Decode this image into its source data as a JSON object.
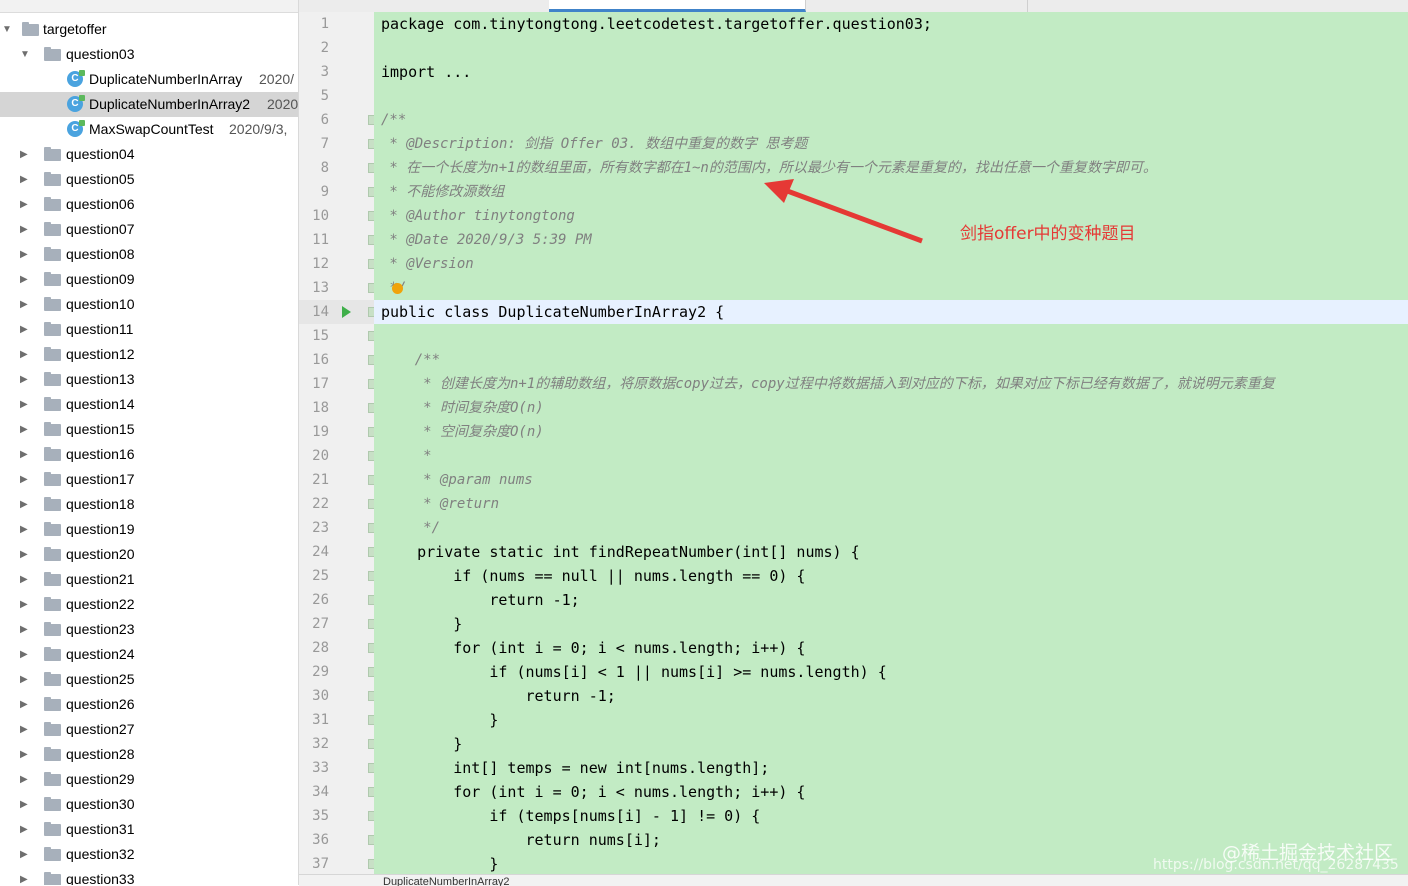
{
  "sidebar": {
    "root": "targetoffer",
    "expanded_folder": "question03",
    "files": [
      {
        "name": "DuplicateNumberInArray",
        "meta": "2020/"
      },
      {
        "name": "DuplicateNumberInArray2",
        "meta": "2020"
      },
      {
        "name": "MaxSwapCountTest",
        "meta": "2020/9/3,"
      }
    ],
    "folders": [
      "question04",
      "question05",
      "question06",
      "question07",
      "question08",
      "question09",
      "question10",
      "question11",
      "question12",
      "question13",
      "question14",
      "question15",
      "question16",
      "question17",
      "question18",
      "question19",
      "question20",
      "question21",
      "question22",
      "question23",
      "question24",
      "question25",
      "question26",
      "question27",
      "question28",
      "question29",
      "question30",
      "question31",
      "question32",
      "question33"
    ]
  },
  "editor": {
    "line_numbers": [
      "1",
      "2",
      "3",
      "5",
      "6",
      "7",
      "8",
      "9",
      "10",
      "11",
      "12",
      "13",
      "14",
      "15",
      "16",
      "17",
      "18",
      "19",
      "20",
      "21",
      "22",
      "23",
      "24",
      "25",
      "26",
      "27",
      "28",
      "29",
      "30",
      "31",
      "32",
      "33",
      "34",
      "35",
      "36",
      "37"
    ],
    "lines": [
      "package com.tinytongtong.leetcodetest.targetoffer.question03;",
      "",
      "import ...",
      "",
      "/**",
      " * @Description: 剑指 Offer 03. 数组中重复的数字 思考题",
      " * 在一个长度为n+1的数组里面，所有数字都在1~n的范围内，所以最少有一个元素是重复的，找出任意一个重复数字即可。",
      " * 不能修改源数组",
      " * @Author tinytongtong",
      " * @Date 2020/9/3 5:39 PM",
      " * @Version",
      " */",
      "public class DuplicateNumberInArray2 {",
      "",
      "    /**",
      "     * 创建长度为n+1的辅助数组，将原数据copy过去，copy过程中将数据插入到对应的下标，如果对应下标已经有数据了，就说明元素重复",
      "     * 时间复杂度O(n)",
      "     * 空间复杂度O(n)",
      "     *",
      "     * @param nums",
      "     * @return",
      "     */",
      "    private static int findRepeatNumber(int[] nums) {",
      "        if (nums == null || nums.length == 0) {",
      "            return -1;",
      "        }",
      "        for (int i = 0; i < nums.length; i++) {",
      "            if (nums[i] < 1 || nums[i] >= nums.length) {",
      "                return -1;",
      "            }",
      "        }",
      "        int[] temps = new int[nums.length];",
      "        for (int i = 0; i < nums.length; i++) {",
      "            if (temps[nums[i] - 1] != 0) {",
      "                return nums[i];",
      "            }"
    ]
  },
  "annotation": {
    "text": "剑指offer中的变种题目",
    "color": "#e53935"
  },
  "bottombar": {
    "filename": "DuplicateNumberInArray2"
  },
  "watermark": {
    "line1": "@稀土掘金技术社区",
    "line2": "https://blog.csdn.net/qq_26287435"
  },
  "colors": {
    "code_bg": "#c2ebc4",
    "current_line": "#e7f1ff",
    "keyword": "#000080",
    "number": "#0000ff"
  }
}
